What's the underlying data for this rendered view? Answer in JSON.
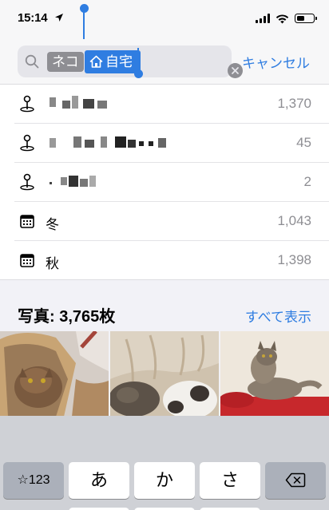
{
  "status_bar": {
    "time": "15:14",
    "signal_bars": 4,
    "battery_level": 0.45
  },
  "search": {
    "tokens": {
      "first": "ネコ",
      "second": "自宅",
      "second_icon": "home-icon"
    },
    "cancel_label": "キャンセル"
  },
  "results": [
    {
      "type": "place",
      "icon": "location-pin-icon",
      "label_redacted": true,
      "count": "1,370"
    },
    {
      "type": "place",
      "icon": "location-pin-icon",
      "label_redacted": true,
      "count": "45"
    },
    {
      "type": "place",
      "icon": "location-pin-icon",
      "label_redacted": true,
      "count": "2"
    },
    {
      "type": "season",
      "icon": "calendar-icon",
      "label": "冬",
      "count": "1,043"
    },
    {
      "type": "season",
      "icon": "calendar-icon",
      "label": "秋",
      "count": "1,398"
    }
  ],
  "photos": {
    "title": "写真: 3,765枚",
    "show_all_label": "すべて表示"
  },
  "keyboard": {
    "mode_key": "☆123",
    "keys": [
      "あ",
      "か",
      "さ"
    ],
    "delete_icon": "backspace-icon"
  },
  "colors": {
    "accent": "#2f7de1",
    "token_gray": "#8e8e93",
    "count_gray": "#8e8e93"
  }
}
